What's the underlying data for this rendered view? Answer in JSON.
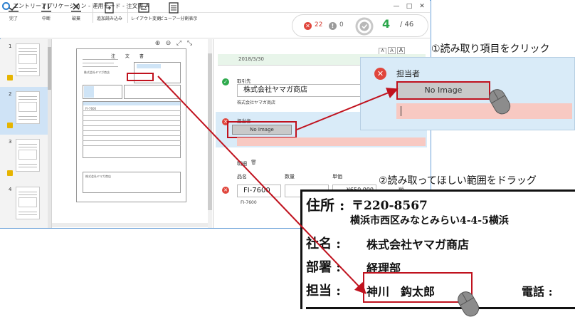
{
  "window": {
    "title": "エントリーアプリケーション - 運用モード - 注文書 A",
    "controls": [
      "—",
      "□",
      "✕"
    ]
  },
  "toolbar": {
    "complete_label": "完了",
    "suspend_label": "中断",
    "discard_label": "破棄",
    "additional_read_label": "追加読み込み",
    "layout_change_label": "レイアウト変更",
    "viewer_split_label": "ビューアー分割表示"
  },
  "status": {
    "errors": "22",
    "warnings": "0",
    "done": "4",
    "total": "/ 46"
  },
  "thumbnails": {
    "pages": [
      "1",
      "2",
      "3",
      "4"
    ],
    "selected_index": 1
  },
  "viewer": {
    "tools": [
      "⊕",
      "⊖",
      "⤢",
      "⤡"
    ],
    "doc_title": "注 文 書",
    "doc_company": "株式会社ヤマガ商店",
    "doc_item": "FI-7600"
  },
  "entry": {
    "size_buttons": [
      "A",
      "A",
      "A"
    ],
    "date_value": "2018/3/30",
    "customer": {
      "label": "取引先",
      "value": "株式会社ヤマガ商店",
      "sub": "株式会社ヤマガ商店"
    },
    "person": {
      "label": "担当者",
      "no_image": "No Image"
    },
    "details": {
      "label": "明細",
      "columns": [
        "品名",
        "数量",
        "単価"
      ],
      "item_value": "FI-7600",
      "item_sub": "FI-7600",
      "price_value": "¥650,000",
      "price_sub": "¥6"
    }
  },
  "callout1": {
    "title": "①読み取り項目をクリック",
    "label": "担当者",
    "no_image": "No Image"
  },
  "callout2": {
    "title": "②読み取ってほしい範囲をドラッグ",
    "address_label": "住所 :",
    "postal": "〒220-8567",
    "address": "横浜市西区みなとみらい4-4-5横浜",
    "company_label": "社名 :",
    "company": "株式会社ヤマガ商店",
    "dept_label": "部署 :",
    "dept": "経理部",
    "person_label": "担当 :",
    "person": "神川　鈎太郎",
    "phone_label": "電話 :"
  },
  "colors": {
    "accent_red": "#c0121e",
    "error": "#e0463c",
    "ok": "#2eaa4d",
    "active_field": "#d9ebf8"
  }
}
